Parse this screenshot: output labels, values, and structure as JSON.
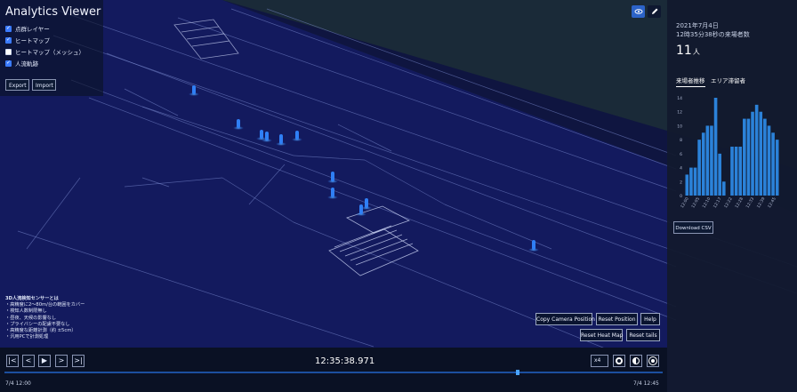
{
  "app": {
    "title": "Analytics Viewer"
  },
  "layers": [
    {
      "label": "点群レイヤー",
      "checked": true
    },
    {
      "label": "ヒートマップ",
      "checked": true
    },
    {
      "label": "ヒートマップ（メッシュ）",
      "checked": false
    },
    {
      "label": "人流軌跡",
      "checked": true
    }
  ],
  "file_buttons": {
    "export": "Export",
    "import": "Import"
  },
  "tools": {
    "orbit_icon": "orbit-icon",
    "pen_icon": "pencil-icon"
  },
  "stats": {
    "date": "2021年7月4日",
    "time_label": "12時35分38秒の来場者数",
    "count": "11",
    "unit": "人"
  },
  "tabs": [
    {
      "label": "来場者推移",
      "active": true
    },
    {
      "label": "エリア滞留者",
      "active": false
    }
  ],
  "chart_data": {
    "type": "bar",
    "ylim": [
      0,
      14
    ],
    "yticks": [
      "0",
      "2",
      "4",
      "6",
      "8",
      "10",
      "12",
      "14"
    ],
    "categories": [
      "12:00",
      "12:02",
      "12:04",
      "12:06",
      "12:08",
      "12:10",
      "12:12",
      "12:14",
      "12:16",
      "12:18",
      "12:20",
      "12:22",
      "12:24",
      "12:26",
      "12:28",
      "12:30",
      "12:32",
      "12:34",
      "12:36",
      "12:38",
      "12:40",
      "12:42",
      "12:44"
    ],
    "xtick_labels": [
      "12:00",
      "12:05",
      "12:10",
      "12:17",
      "12:22",
      "12:28",
      "12:33",
      "12:39",
      "12:45"
    ],
    "values": [
      3,
      4,
      4,
      8,
      9,
      10,
      10,
      14,
      6,
      2,
      0,
      7,
      7,
      7,
      11,
      11,
      12,
      13,
      12,
      11,
      10,
      9,
      8
    ],
    "bar_color": "#2b82d9"
  },
  "download_label": "Download CSV",
  "info": {
    "heading": "3D人流検知センサーとは",
    "lines": [
      "・高精度に2〜80m/台の範囲をカバー",
      "・検知人数制限無し",
      "・昼夜、天候の影響なし",
      "・プライバシーの配慮不要なし",
      "・高精度な距離計測（約 ±5cm）",
      "・汎用PCで計測処理"
    ]
  },
  "actions": {
    "copy_camera": "Copy Camera Position",
    "reset_position": "Reset Position",
    "help": "Help",
    "reset_heatmap": "Reset Heat Map",
    "reset_tails": "Reset tails"
  },
  "playback": {
    "buttons": [
      "|<",
      "<",
      "▶",
      ">",
      ">|"
    ],
    "clock": "12:35:38.971",
    "speed": "x4",
    "progress": 0.78,
    "start_label": "7/4 12:00",
    "end_label": "7/4 12:45"
  },
  "colors": {
    "accent": "#3b7bff",
    "scene": "#11195a",
    "person": "#2f7ff5"
  }
}
